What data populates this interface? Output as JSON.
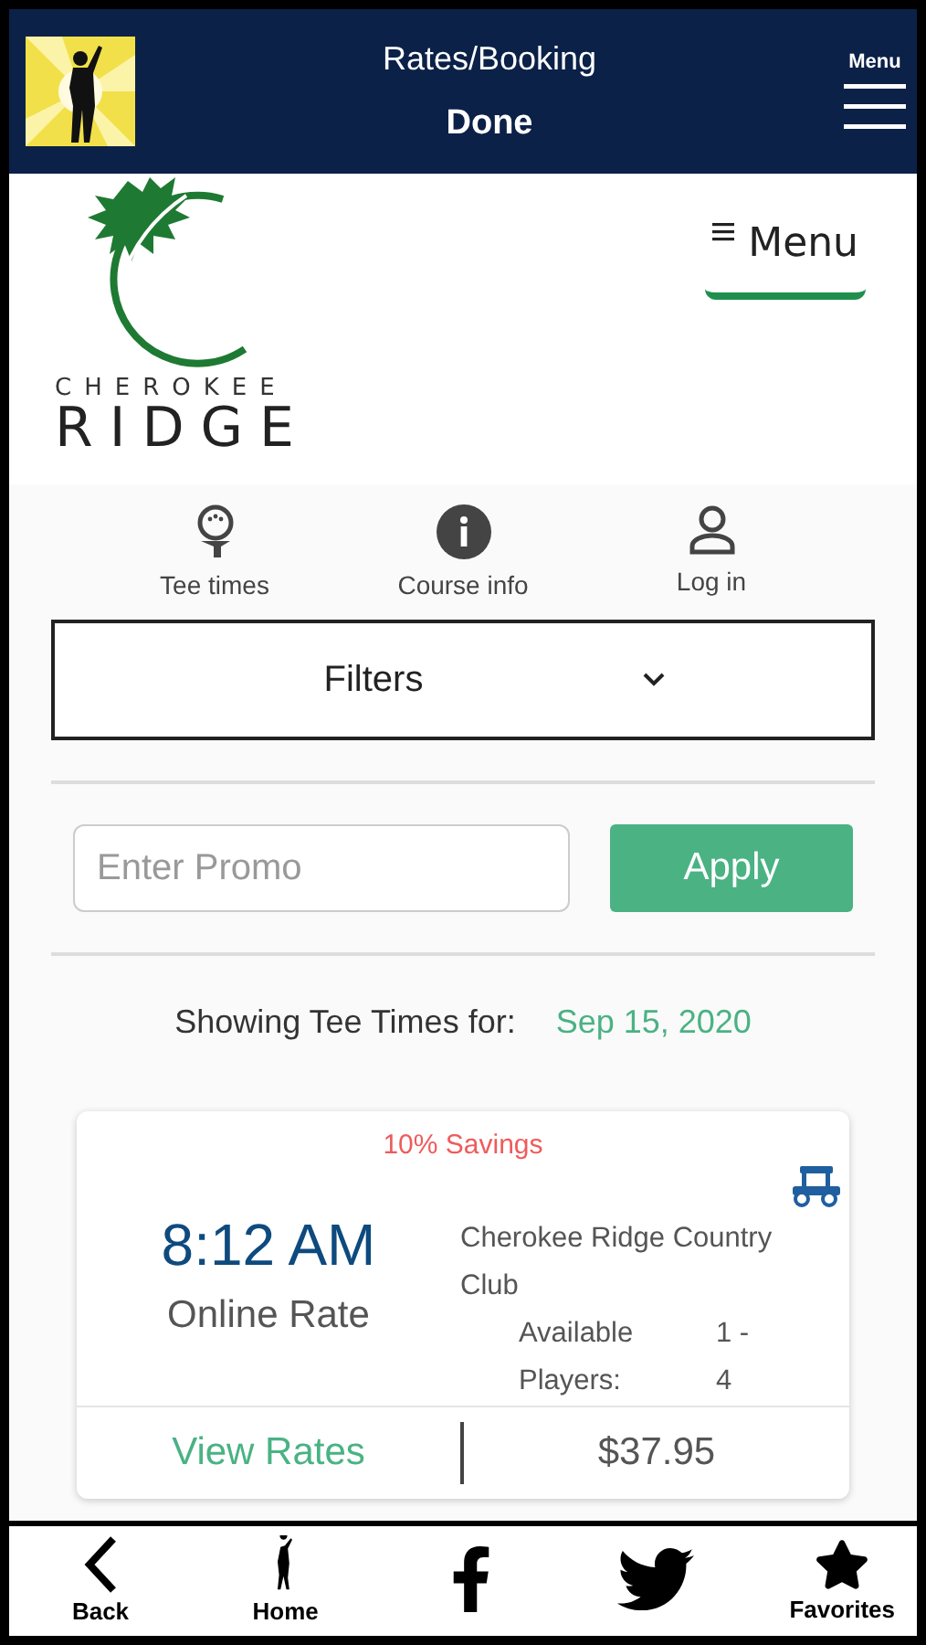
{
  "top_bar": {
    "title": "Rates/Booking",
    "subtitle": "Done",
    "menu_label": "Menu"
  },
  "site_header": {
    "logo_line_1": "CHEROKEE",
    "logo_line_2": "RIDGE",
    "menu_button": "Menu"
  },
  "nav": [
    {
      "label": "Tee times",
      "kind": "tee"
    },
    {
      "label": "Course info",
      "kind": "info"
    },
    {
      "label": "Log in",
      "kind": "user"
    }
  ],
  "filters": {
    "label": "Filters"
  },
  "promo": {
    "placeholder": "Enter Promo",
    "button": "Apply"
  },
  "showing": {
    "label": "Showing Tee Times for:",
    "date": "Sep 15, 2020"
  },
  "tee_times": [
    {
      "savings": "10% Savings",
      "time": "8:12 AM",
      "rate": "Online Rate",
      "course": "Cherokee Ridge Country Club",
      "players_label": "Available Players:",
      "players_value": "1 - 4",
      "view_rates": "View Rates",
      "price": "$37.95"
    }
  ],
  "bottom_bar": [
    {
      "label": "Back",
      "kind": "back"
    },
    {
      "label": "Home",
      "kind": "home"
    },
    {
      "kind": "facebook"
    },
    {
      "kind": "twitter"
    },
    {
      "label": "Favorites",
      "kind": "star"
    }
  ]
}
